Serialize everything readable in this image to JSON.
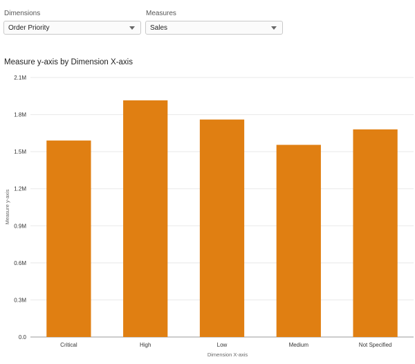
{
  "controls": {
    "dimensions_label": "Dimensions",
    "dimensions_value": "Order Priority",
    "measures_label": "Measures",
    "measures_value": "Sales"
  },
  "colors": {
    "bar": "#e07f12",
    "grid": "#e8e8e8",
    "axis": "#999999"
  },
  "chart_data": {
    "type": "bar",
    "title": "Measure y-axis by Dimension X-axis",
    "xlabel": "Dimension X-axis",
    "ylabel": "Measure y-axis",
    "categories": [
      "Critical",
      "High",
      "Low",
      "Medium",
      "Not Specified"
    ],
    "values": [
      1590000,
      1915000,
      1760000,
      1555000,
      1680000
    ],
    "ylim": [
      0,
      2100000
    ],
    "yticks": [
      0,
      300000,
      600000,
      900000,
      1200000,
      1500000,
      1800000,
      2100000
    ],
    "ytick_labels": [
      "0.0",
      "0.3M",
      "0.6M",
      "0.9M",
      "1.2M",
      "1.5M",
      "1.8M",
      "2.1M"
    ],
    "grid": true,
    "legend": "none"
  }
}
